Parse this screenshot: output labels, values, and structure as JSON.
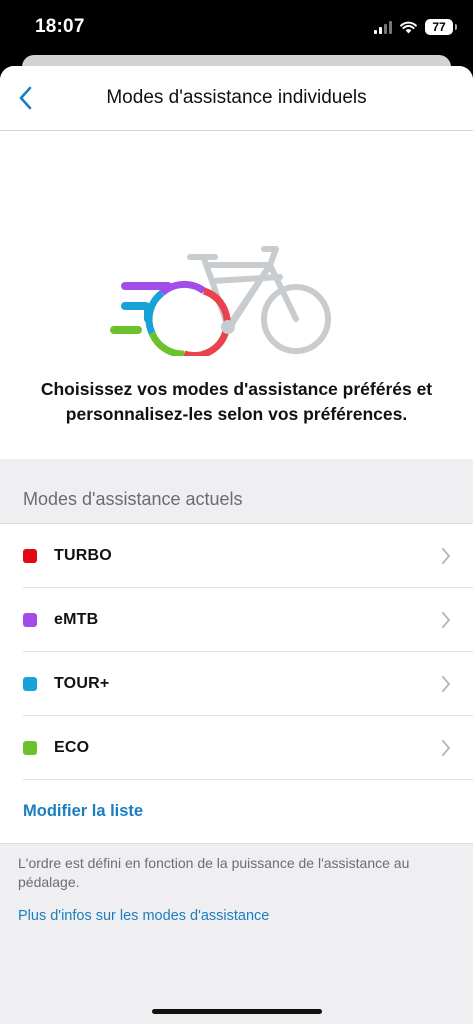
{
  "status_bar": {
    "time": "18:07",
    "battery": "77"
  },
  "nav": {
    "title": "Modes d'assistance individuels",
    "back_icon": "chevron-left-icon"
  },
  "hero": {
    "illustration": "ebike-illustration",
    "text": "Choisissez vos modes d'assistance préférés et personnalisez-les selon vos préférences."
  },
  "modes_section": {
    "header": "Modes d'assistance actuels",
    "items": [
      {
        "label": "TURBO",
        "color": "#e30613"
      },
      {
        "label": "eMTB",
        "color": "#a24de8"
      },
      {
        "label": "TOUR+",
        "color": "#17a2d8"
      },
      {
        "label": "ECO",
        "color": "#6cc22a"
      }
    ],
    "edit_label": "Modifier la liste"
  },
  "footer": {
    "note": "L'ordre est défini en fonction de la puissance de l'assistance au pédalage.",
    "link": "Plus d'infos sur les modes d'assistance"
  },
  "colors": {
    "accent": "#1a7fc1",
    "background": "#efeff1"
  }
}
